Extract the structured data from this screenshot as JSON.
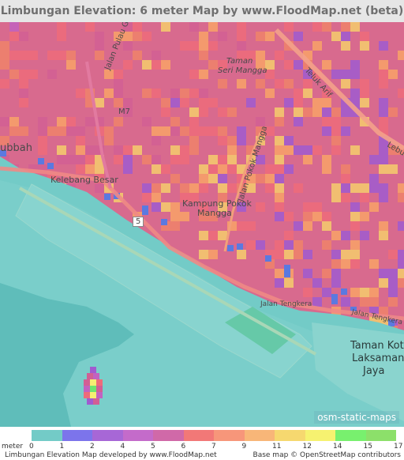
{
  "title": "Limbungan Elevation: 6 meter Map by www.FloodMap.net (beta)",
  "map": {
    "labels": [
      {
        "text": "Jalan Pulau Gading"
      },
      {
        "text": "Taman"
      },
      {
        "text": "Seri Mangga"
      },
      {
        "text": "Teluk Arif"
      },
      {
        "text": "M7"
      },
      {
        "text": "ubbah"
      },
      {
        "text": "Lebuh"
      },
      {
        "text": "Kelebang Besar"
      },
      {
        "text": "Jalan Pokok Mangga"
      },
      {
        "text": "Kampung Pokok"
      },
      {
        "text": "Mangga"
      },
      {
        "text": "5"
      },
      {
        "text": "Jalan Tengkera"
      },
      {
        "text": "Jalan Tengkera"
      },
      {
        "text": "Taman Kota"
      },
      {
        "text": "Laksamana"
      },
      {
        "text": "Jaya"
      }
    ],
    "badge": "osm-static-maps",
    "colors": {
      "sea": "#73cbc7",
      "elev_1": "#5b79e0",
      "elev_2": "#a05bd0",
      "elev_4": "#c262c0",
      "elev_5": "#d25f94",
      "elev_6": "#ee6b7a",
      "elev_7": "#f0826a",
      "elev_9": "#f9a267",
      "elev_11": "#f6cc6c",
      "elev_12": "#f6ef72",
      "elev_14": "#6fe56f",
      "elev_15": "#82d866"
    }
  },
  "legend": {
    "unit": "meter",
    "ticks": [
      "0",
      "1",
      "2",
      "4",
      "5",
      "6",
      "7",
      "9",
      "11",
      "12",
      "14",
      "15",
      "17"
    ],
    "swatches": [
      "#73cbc7",
      "#7c74eb",
      "#a767d6",
      "#c46bca",
      "#d069a8",
      "#f27877",
      "#f7967a",
      "#f8b678",
      "#f6d86f",
      "#f6f270",
      "#78f06e",
      "#8ce06a"
    ]
  },
  "credits": {
    "left": "Limbungan Elevation Map developed by www.FloodMap.net",
    "right": "Base map © OpenStreetMap contributors"
  }
}
